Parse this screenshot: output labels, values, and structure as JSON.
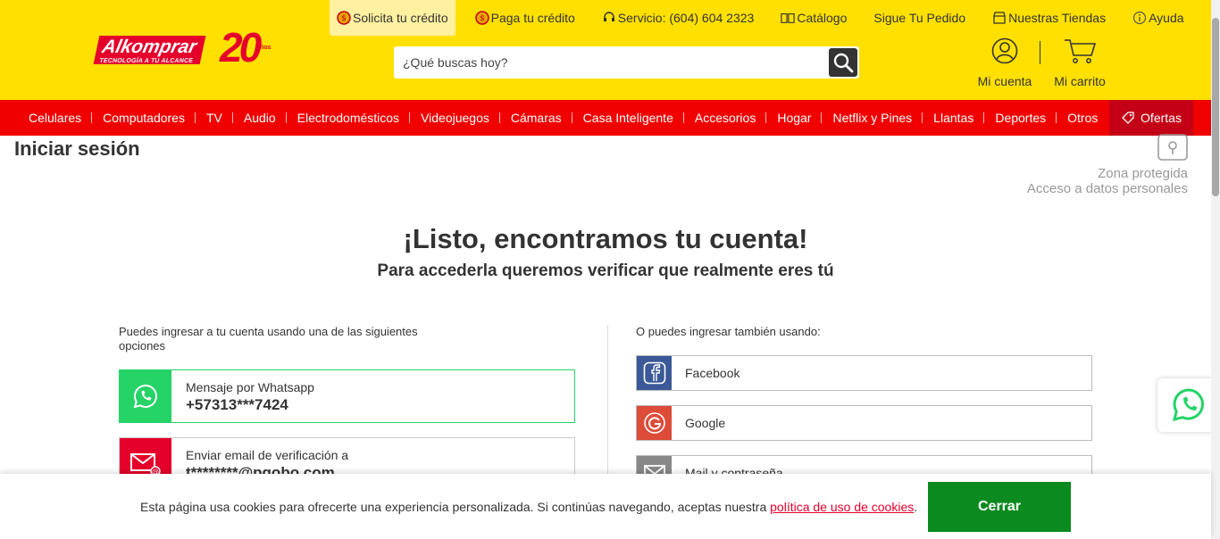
{
  "header": {
    "logo_text": "Alkomprar",
    "logo_tagline": "TECNOLOGÍA A TU ALCANCE",
    "logo_anniversary": "20",
    "logo_anniversary_unit": "Años",
    "top_links": [
      {
        "label": "Solicita tu crédito",
        "icon": "credit-coin-icon",
        "active": true
      },
      {
        "label": "Paga tu crédito",
        "icon": "pay-coin-icon",
        "active": false
      },
      {
        "label": "Servicio: (604) 604 2323",
        "icon": "headset-icon",
        "active": false
      },
      {
        "label": "Catálogo",
        "icon": "catalog-book-icon",
        "active": false
      },
      {
        "label": "Sigue Tu Pedido",
        "icon": "",
        "active": false
      },
      {
        "label": "Nuestras Tiendas",
        "icon": "store-icon",
        "active": false
      },
      {
        "label": "Ayuda",
        "icon": "info-icon",
        "active": false
      }
    ],
    "search_placeholder": "¿Qué buscas hoy?",
    "account_label": "Mi cuenta",
    "cart_label": "Mi carrito"
  },
  "nav": {
    "items": [
      "Celulares",
      "Computadores",
      "TV",
      "Audio",
      "Electrodomésticos",
      "Videojuegos",
      "Cámaras",
      "Casa Inteligente",
      "Accesorios",
      "Hogar",
      "Netflix y Pines",
      "Llantas",
      "Deportes",
      "Otros"
    ],
    "offers_label": "Ofertas"
  },
  "page": {
    "title": "Iniciar sesión",
    "zone_line1": "Zona protegida",
    "zone_line2": "Acceso a datos personales",
    "heading": "¡Listo, encontramos tu cuenta!",
    "subheading": "Para accederla queremos verificar que realmente eres tú"
  },
  "left": {
    "intro": "Puedes ingresar a tu cuenta usando una de las siguientes opciones",
    "whatsapp_label": "Mensaje por Whatsapp",
    "whatsapp_value": "+57313***7424",
    "email_label": "Enviar email de verificación a",
    "email_value": "t********@pgobo.com"
  },
  "right": {
    "intro": "O puedes ingresar también usando:",
    "facebook": "Facebook",
    "google": "Google",
    "mail": "Mail y contraseña"
  },
  "cookie": {
    "text": "Esta página usa cookies para ofrecerte una experiencia personalizada. Si continúas navegando, aceptas nuestra",
    "link": "política de uso de cookies",
    "suffix": ".",
    "button": "Cerrar"
  },
  "colors": {
    "header_bg": "#ffe000",
    "nav_bg": "#f00000",
    "offers_bg": "#c40016",
    "whatsapp": "#25d366",
    "email": "#e4002b",
    "facebook": "#3b5998",
    "google": "#dd4b39",
    "cookie_button": "#0b8a1f"
  }
}
